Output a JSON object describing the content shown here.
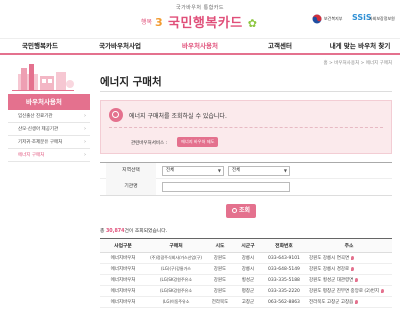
{
  "header": {
    "subtitle": "국가바우처 통합카드",
    "logo_emblem_text": "행복 3",
    "logo_name": "국민행복카드",
    "ministry_name": "보건복지부",
    "ssis_logo": "SSiS",
    "ssis_name": "사회보장정보원"
  },
  "nav": {
    "items": [
      {
        "label": "국민행복카드"
      },
      {
        "label": "국가바우처사업"
      },
      {
        "label": "바우처사용처"
      },
      {
        "label": "고객센터"
      },
      {
        "label": "내게 맞는 바우처 찾기"
      }
    ]
  },
  "sidebar": {
    "title": "바우처사용처",
    "items": [
      {
        "label": "임신출산 진료기관"
      },
      {
        "label": "산모·신생아 제공기관"
      },
      {
        "label": "기저귀·조제분유 구매처"
      },
      {
        "label": "에너지 구매처"
      }
    ]
  },
  "main": {
    "breadcrumb": "홈 > 바우처사용처 > 에너지 구매처",
    "title": "에너지 구매처",
    "info_text": "에너지 구매처를 조회하실 수 있습니다.",
    "related_label": "관련바우처서비스 :",
    "related_tag": "에너지 바우처 제도"
  },
  "search": {
    "region_label": "지역선택",
    "region_select_1": "전체",
    "region_select_2": "전체",
    "name_label": "기관명",
    "name_value": "",
    "button_label": "조회"
  },
  "results": {
    "count_prefix": "총",
    "count": "30,874",
    "count_suffix": "건이 조회되었습니다.",
    "columns": [
      "사업구분",
      "구매처",
      "시도",
      "시군구",
      "전화번호",
      "주소"
    ],
    "rows": [
      {
        "type": "에너지바우처",
        "name": "(주)정광주식회사/가스산업(구)",
        "sido": "강원도",
        "sigungu": "강릉시",
        "phone": "033-643-9101",
        "addr": "강원도 강릉시 연곡면"
      },
      {
        "type": "에너지바우처",
        "name": "(LG)(구)강릉가스",
        "sido": "강원도",
        "sigungu": "강릉시",
        "phone": "033-648-5149",
        "addr": "강원도 강릉시 경강로"
      },
      {
        "type": "에너지바우처",
        "name": "(LG)SK강원주유소",
        "sido": "강원도",
        "sigungu": "횡성군",
        "phone": "033-335-5188",
        "addr": "강원도 횡성군 대관령면"
      },
      {
        "type": "에너지바우처",
        "name": "(LG)SK강원주유소",
        "sido": "강원도",
        "sigungu": "평창군",
        "phone": "033-335-2220",
        "addr": "강원도 평창군 진부면 중앙로 (2)번지"
      },
      {
        "type": "에너지바우처",
        "name": "(LG)이동주유소",
        "sido": "전라북도",
        "sigungu": "고창군",
        "phone": "063-562-8863",
        "addr": "전라북도 고창군 고창읍"
      }
    ]
  },
  "colors": {
    "accent": "#e4718e",
    "accent_text": "#e0507a",
    "info_bg": "#fbeaec"
  }
}
